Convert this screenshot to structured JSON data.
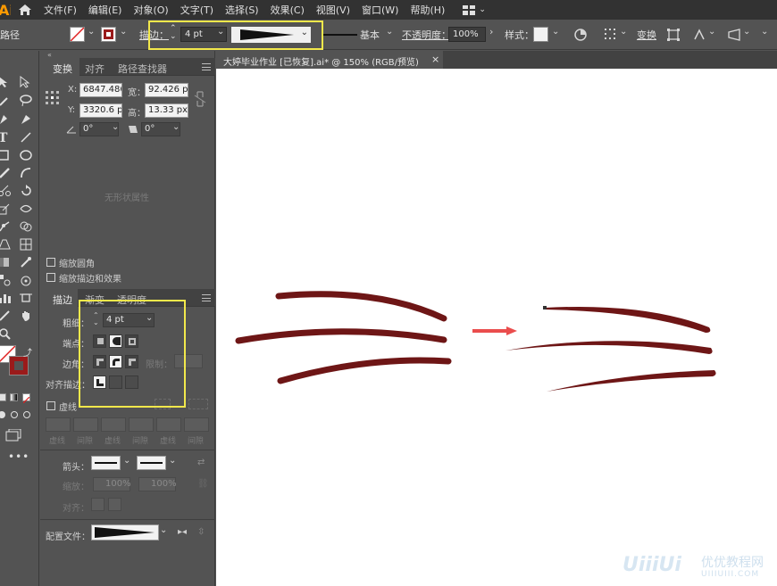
{
  "menubar": {
    "app_logo": "Ai",
    "items": [
      "文件(F)",
      "编辑(E)",
      "对象(O)",
      "文字(T)",
      "选择(S)",
      "效果(C)",
      "视图(V)",
      "窗口(W)",
      "帮助(H)"
    ]
  },
  "controlbar": {
    "object_label": "路径",
    "stroke_label": "描边：",
    "stroke_weight": "4 pt",
    "brush_label": "基本",
    "opacity_label": "不透明度：",
    "opacity_value": "100%",
    "style_label": "样式：",
    "transform_label": "变换"
  },
  "transform_panel": {
    "tabs": [
      "变换",
      "对齐",
      "路径查找器"
    ],
    "x_label": "X:",
    "x_value": "6847.486",
    "w_label": "宽：",
    "w_value": "92.426 p",
    "y_label": "Y:",
    "y_value": "3320.6 p",
    "h_label": "高：",
    "h_value": "13.33 px",
    "angle_value": "0°",
    "shear_value": "0°",
    "no_shape": "无形状属性",
    "scale_corners": "缩放圆角",
    "scale_strokes": "缩放描边和效果"
  },
  "stroke_panel": {
    "tabs": [
      "描边",
      "渐变",
      "透明度"
    ],
    "weight_label": "粗细：",
    "weight_value": "4 pt",
    "cap_label": "端点：",
    "corner_label": "边角：",
    "limit_label": "限制：",
    "align_label": "对齐描边：",
    "dashed_label": "虚线",
    "dash_labels": [
      "虚线",
      "间隙",
      "虚线",
      "间隙",
      "虚线",
      "间隙"
    ],
    "arrow_label": "箭头：",
    "scale_label": "缩放：",
    "scale_value_1": "100%",
    "scale_value_2": "100%",
    "align_arrow_label": "对齐：",
    "profile_label": "配置文件："
  },
  "document": {
    "tab_title": "大婷毕业作业  [已恢复].ai* @ 150% (RGB/预览)",
    "close": "×"
  },
  "watermark": {
    "logo": "UiiiUi",
    "cn": "优优教程网",
    "url": "UIIIUIII.COM"
  },
  "colors": {
    "stroke_color": "#6e1616",
    "arrow_red": "#e83a3a",
    "highlight": "#f2e84b"
  }
}
